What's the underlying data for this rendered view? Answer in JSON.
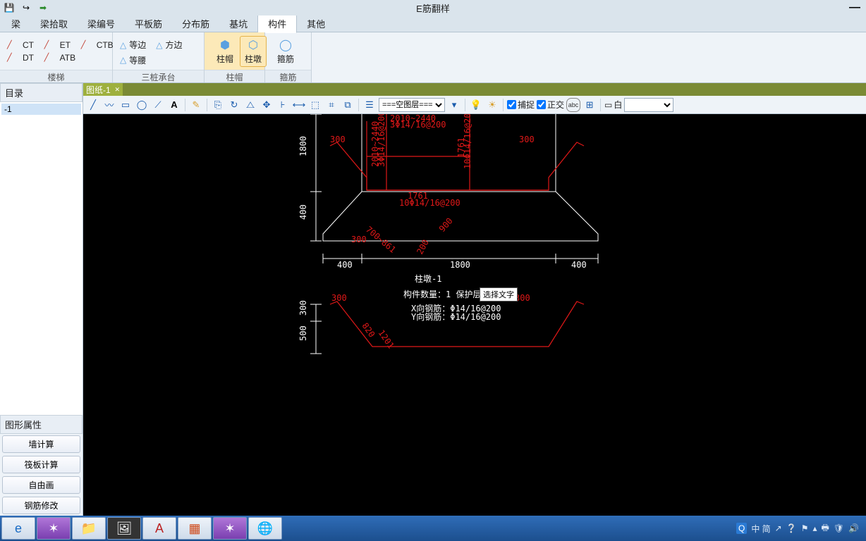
{
  "app_title": "E筋翻样",
  "menu": {
    "items": [
      "梁",
      "梁拾取",
      "梁编号",
      "平板筋",
      "分布筋",
      "基坑",
      "构件",
      "其他"
    ],
    "active": 6
  },
  "ribbon": {
    "g1": {
      "foot": "楼梯",
      "rows": [
        [
          "CT",
          "ET",
          "CTB"
        ],
        [
          "DT",
          "ATB"
        ]
      ]
    },
    "g2": {
      "foot": "三桩承台",
      "items": [
        "等边",
        "方边",
        "等腰"
      ]
    },
    "g3": {
      "foot": "柱帽",
      "items": [
        "柱帽",
        "柱墩"
      ],
      "sel": 1
    },
    "g4": {
      "foot": "箍筋",
      "item": "箍筋"
    }
  },
  "sidebar": {
    "tree_title": "目录",
    "tree_item": "-1",
    "prop_title": "图形属性",
    "buttons": [
      "墙计算",
      "筏板计算",
      "自由画",
      "钢筋修改"
    ]
  },
  "tab": {
    "label": "图纸-1"
  },
  "toolstrip": {
    "layer_select": "===空图层===",
    "snap": "捕捉",
    "ortho": "正交",
    "color": "白"
  },
  "tooltip": "选择文字",
  "drawing": {
    "title": "柱墩-1",
    "count_label": "构件数量：1   保护层：40",
    "xrebar": "X向钢筋：Φ14/16@200",
    "yrebar": "Y向钢筋：Φ14/16@200",
    "dims": {
      "h1800": "1800",
      "h400": "400",
      "w400l": "400",
      "w1800": "1800",
      "w400r": "400",
      "h300": "300",
      "h500": "500",
      "d300l": "300",
      "d300r": "300",
      "d1761": "1761",
      "note1": "10Φ14/16@200",
      "topnote": "2010~2440",
      "topnote2": "3Φ14/16@200",
      "v1761": "1761",
      "vnote": "10Φ14/16@200",
      "a700": "700~861",
      "a900": "900",
      "a200": "200",
      "a300b": "300"
    }
  },
  "taskbar": {
    "tray_text": "中 简"
  }
}
